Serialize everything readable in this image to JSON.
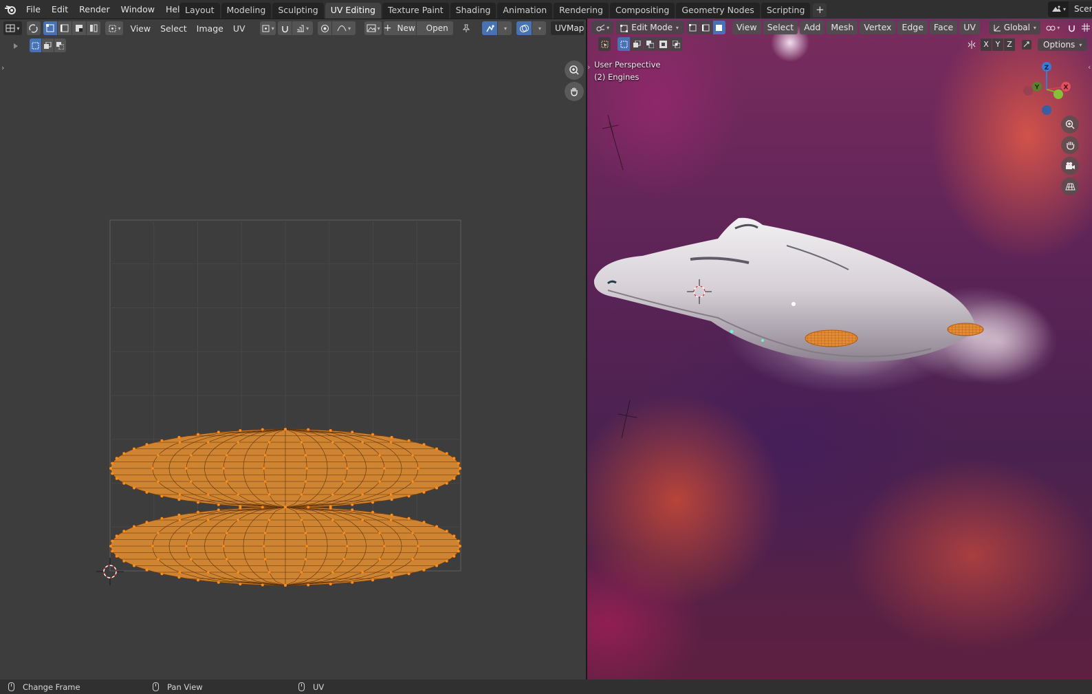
{
  "topbar": {
    "menus": [
      "File",
      "Edit",
      "Render",
      "Window",
      "Help"
    ],
    "workspaces": [
      "Layout",
      "Modeling",
      "Sculpting",
      "UV Editing",
      "Texture Paint",
      "Shading",
      "Animation",
      "Rendering",
      "Compositing",
      "Geometry Nodes",
      "Scripting"
    ],
    "active_workspace": "UV Editing",
    "add_workspace": "+",
    "scene_name": "Scen"
  },
  "uv_editor": {
    "menus": [
      "View",
      "Select",
      "Image",
      "UV"
    ],
    "new_label": "New",
    "open_label": "Open",
    "uvmap_label": "UVMap",
    "uv_face_color": "#e8902f",
    "uv_vertex_color": "#ff8c1a"
  },
  "viewport": {
    "mode": "Edit Mode",
    "menus": [
      "View",
      "Select",
      "Add",
      "Mesh",
      "Vertex",
      "Edge",
      "Face",
      "UV"
    ],
    "orientation": "Global",
    "axes": [
      "X",
      "Y",
      "Z"
    ],
    "options_label": "Options",
    "perspective_label": "User Perspective",
    "object_label": "(2) Engines",
    "gizmo": {
      "x": "X",
      "y": "Y",
      "z": "Z"
    }
  },
  "statusbar": {
    "items": [
      "Change Frame",
      "Pan View",
      "UV"
    ]
  }
}
